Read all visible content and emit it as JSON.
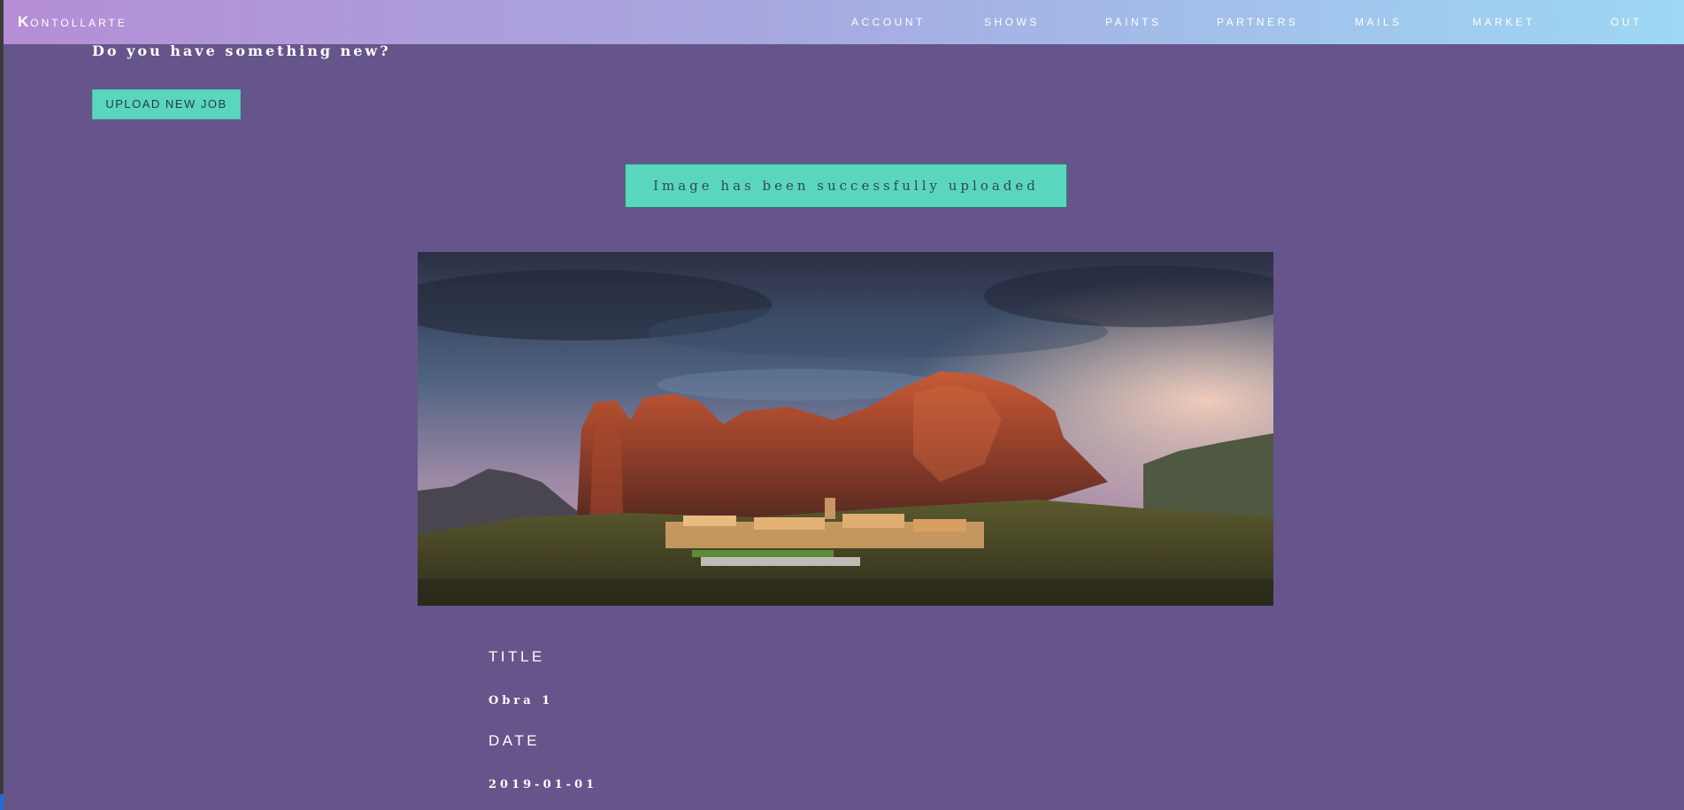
{
  "brand": {
    "first_letter": "K",
    "rest": "ONTOLLARTE"
  },
  "nav": {
    "items": [
      "ACCOUNT",
      "SHOWS",
      "PAINTS",
      "PARTNERS",
      "MAILS",
      "MARKET",
      "OUT"
    ]
  },
  "upload": {
    "prompt": "Do you have something new?",
    "button_label": "UPLOAD NEW JOB"
  },
  "alert": {
    "message": "Image has been successfully uploaded"
  },
  "artwork": {
    "image_subject": "landscape-photo-red-rock-cliffs-village-sunset",
    "fields": [
      {
        "label": "TITLE",
        "value": "Obra 1"
      },
      {
        "label": "DATE",
        "value": "2019-01-01"
      }
    ]
  },
  "colors": {
    "background": "#66558a",
    "accent": "#5bd6be",
    "nav_gradient_start": "#b58ed6",
    "nav_gradient_end": "#9dd8f4"
  }
}
